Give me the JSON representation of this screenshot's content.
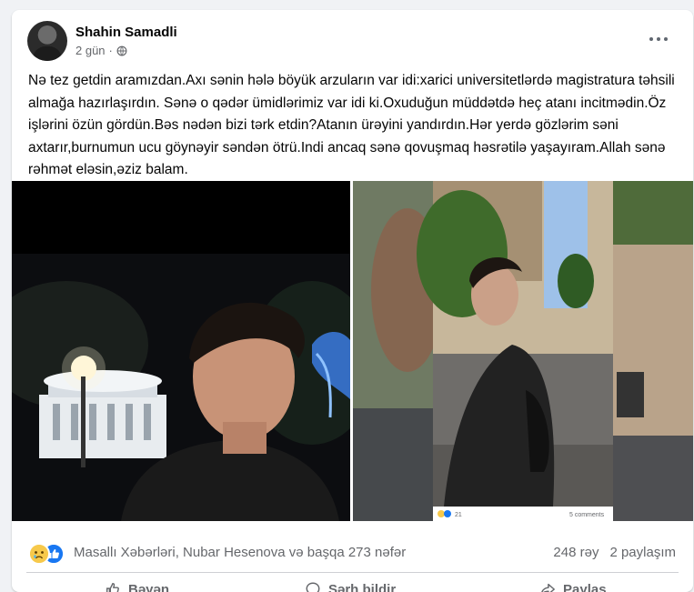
{
  "post": {
    "author": "Shahin Samadli",
    "time": "2 gün",
    "separator": "·",
    "text": "Nə tez getdin aramızdan.Axı sənin hələ böyük arzuların var idi:xarici universitetlərdə magistratura təhsili almağa hazırlaşırdın. Sənə o qədər ümidlərimiz var idi ki.Oxuduğun müddətdə heç atanı incitmədin.Öz işlərini özün gördün.Bəs nədən bizi tərk etdin?Atanın ürəyini yandırdın.Hər yerdə gözlərim səni axtarır,burnumun ucu göynəyir səndən ötrü.Indi ancaq sənə qovuşmaq həsrətilə yaşayıram.Allah sənə rəhmət eləsin,əziz balam."
  },
  "embedded_screenshot": {
    "reaction_count": "21",
    "comments": "5 comments"
  },
  "reactions": {
    "names": "Masallı Xəbərləri, Nubar Hesenova və başqa 273 nəfər",
    "comments": "248 rəy",
    "shares": "2 paylaşım"
  },
  "actions": {
    "like": "Bəyən",
    "comment": "Şərh bildir",
    "share": "Paylaş"
  },
  "colors": {
    "background": "#f0f2f5",
    "card": "#ffffff",
    "secondary_text": "#65676b",
    "like_blue": "#1877f2",
    "sad_yellow": "#f7c94b"
  },
  "icons": [
    "globe-icon",
    "more-icon",
    "sad-reaction-icon",
    "like-reaction-icon",
    "like-icon",
    "comment-icon",
    "share-icon"
  ]
}
